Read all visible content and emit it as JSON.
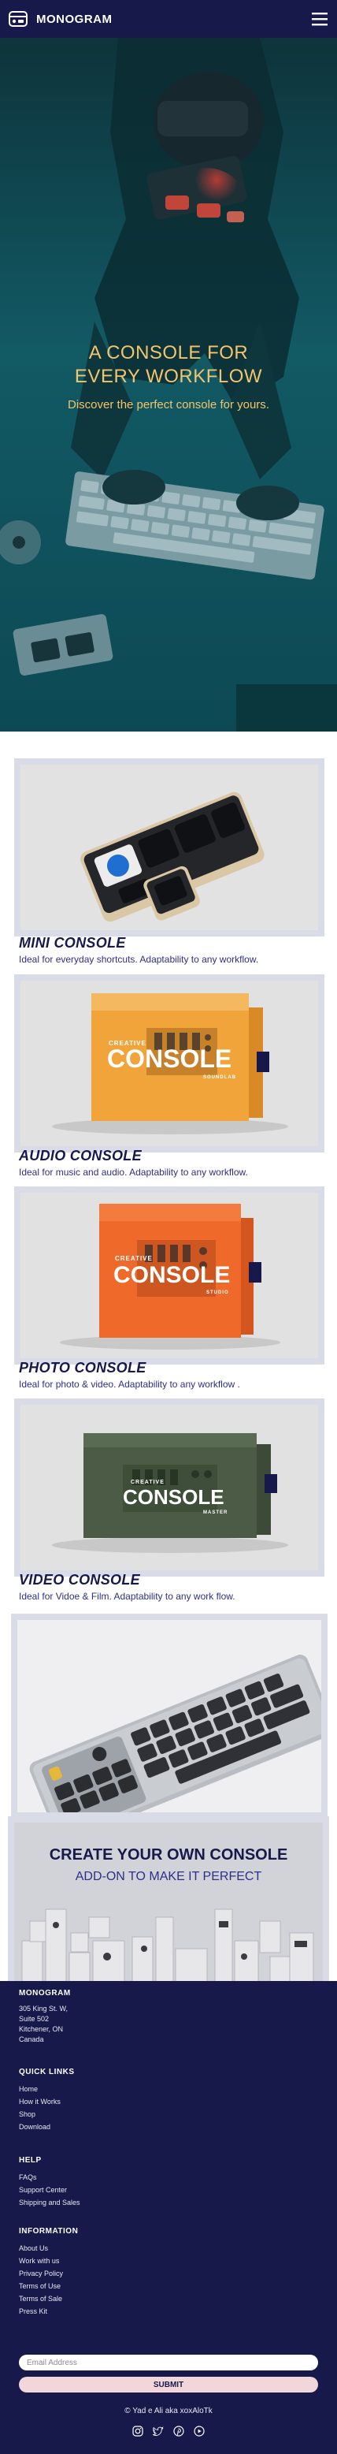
{
  "brand": {
    "name": "MONOGRAM"
  },
  "hero": {
    "title": "A CONSOLE FOR\nEVERY WORKFLOW",
    "subtitle": "Discover the perfect console for yours."
  },
  "products": [
    {
      "name": "MINI CONSOLE",
      "description": "Ideal for everyday shortcuts. Adaptability to any workflow."
    },
    {
      "name": "AUDIO CONSOLE",
      "description": "Ideal for music and audio. Adaptability to any workflow.",
      "box_word": "CONSOLE",
      "box_small": "CREATIVE",
      "box_edition": "SOUNDLAB"
    },
    {
      "name": "PHOTO CONSOLE",
      "description": "Ideal for photo & video. Adaptability to any workflow .",
      "box_word": "CONSOLE",
      "box_small": "CREATIVE",
      "box_edition": "STUDIO"
    },
    {
      "name": "VIDEO CONSOLE",
      "description": "Ideal for Vidoe & Film. Adaptability to any work flow.",
      "box_word": "CONSOLE",
      "box_small": "CREATIVE",
      "box_edition": "MASTER"
    }
  ],
  "create": {
    "title": "CREATE YOUR OWN CONSOLE",
    "subtitle": "ADD-ON TO MAKE IT PERFECT"
  },
  "footer": {
    "brand": "MONOGRAM",
    "address": [
      "305 King St. W,",
      "Suite 502",
      "Kitchener, ON",
      "Canada"
    ],
    "quick_links": {
      "heading": "QUICK LINKS",
      "items": [
        "Home",
        "How it Works",
        "Shop",
        "Download"
      ]
    },
    "help": {
      "heading": "HELP",
      "items": [
        "FAQs",
        "Support Center",
        "Shipping and Sales"
      ]
    },
    "information": {
      "heading": "INFORMATION",
      "items": [
        "About Us",
        "Work with us",
        "Privacy Policy",
        "Terms of Use",
        "Terms of Sale",
        "Press Kit"
      ]
    },
    "email_placeholder": "Email Address",
    "submit_label": "SUBMIT",
    "copyright": "© Yad e Ali aka xoxAloTk",
    "socials": [
      "instagram-icon",
      "twitter-icon",
      "pinterest-icon",
      "youtube-icon"
    ]
  },
  "colors": {
    "navy": "#17194a",
    "gold": "#f2c56d",
    "orange_box": "#f0a43a",
    "red_orange_box": "#ef6a2a",
    "green_box": "#4b5b45",
    "card_border": "#d9dbe7"
  }
}
